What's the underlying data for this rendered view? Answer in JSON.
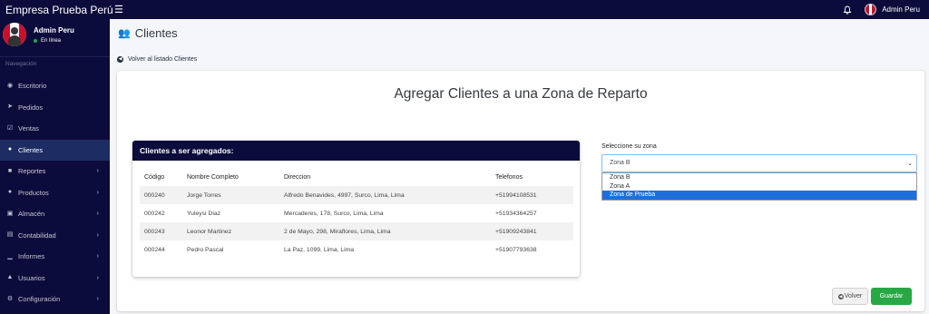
{
  "header": {
    "brand": "Empresa Prueba Perú",
    "user_name": "Admin Peru"
  },
  "sidebar": {
    "user_name": "Admin Peru",
    "status": "En línea",
    "nav_header": "Navegación",
    "items": [
      {
        "label": "Escritorio",
        "icon": "tachometer-icon",
        "has_children": false
      },
      {
        "label": "Pedidos",
        "icon": "paper-plane-icon",
        "has_children": false
      },
      {
        "label": "Ventas",
        "icon": "check-square-icon",
        "has_children": false
      },
      {
        "label": "Clientes",
        "icon": "users-icon",
        "has_children": false,
        "active": true
      },
      {
        "label": "Reportes",
        "icon": "truck-icon",
        "has_children": true
      },
      {
        "label": "Productos",
        "icon": "box-icon",
        "has_children": true
      },
      {
        "label": "Almacén",
        "icon": "boxes-icon",
        "has_children": true
      },
      {
        "label": "Contabilidad",
        "icon": "money-icon",
        "has_children": true
      },
      {
        "label": "Informes",
        "icon": "chart-icon",
        "has_children": true
      },
      {
        "label": "Usuarios",
        "icon": "user-tie-icon",
        "has_children": true
      },
      {
        "label": "Configuración",
        "icon": "cogs-icon",
        "has_children": true
      }
    ]
  },
  "page": {
    "title": "Clientes",
    "back_link": "Volver al listado Clientes",
    "card_title": "Agregar Clientes a una Zona de Reparto"
  },
  "clients_table": {
    "header": "Clientes a ser agregados:",
    "columns": [
      "Código",
      "Nombre Completo",
      "Direccion",
      "Telefonos"
    ],
    "rows": [
      [
        "000240",
        "Jorge Torres",
        "Alfredo Benavides, 4997, Surco, Lima, Lima",
        "+51994108531"
      ],
      [
        "000242",
        "Yuleysi Diaz",
        "Mercaderes, 178, Surco, Lima, Lima",
        "+51934364257"
      ],
      [
        "000243",
        "Leonor Martinez",
        "2 de Mayo, 298, Miraflores, Lima, Lima",
        "+51909243841"
      ],
      [
        "000244",
        "Pedro Pascal",
        "La Paz, 1099, Lima, Lima",
        "+51907793638"
      ]
    ]
  },
  "zone": {
    "label": "Seleccione su zona",
    "selected": "Zona B",
    "options": [
      "Zona B",
      "Zona A",
      "Zona de Prueba"
    ],
    "highlighted_option": "Zona de Prueba"
  },
  "buttons": {
    "back": "Volver",
    "save": "Guardar"
  },
  "colors": {
    "navy": "#0c0c3c",
    "active_nav": "#1d2c63",
    "save_green": "#28a745",
    "option_highlight": "#1e6fd9"
  }
}
